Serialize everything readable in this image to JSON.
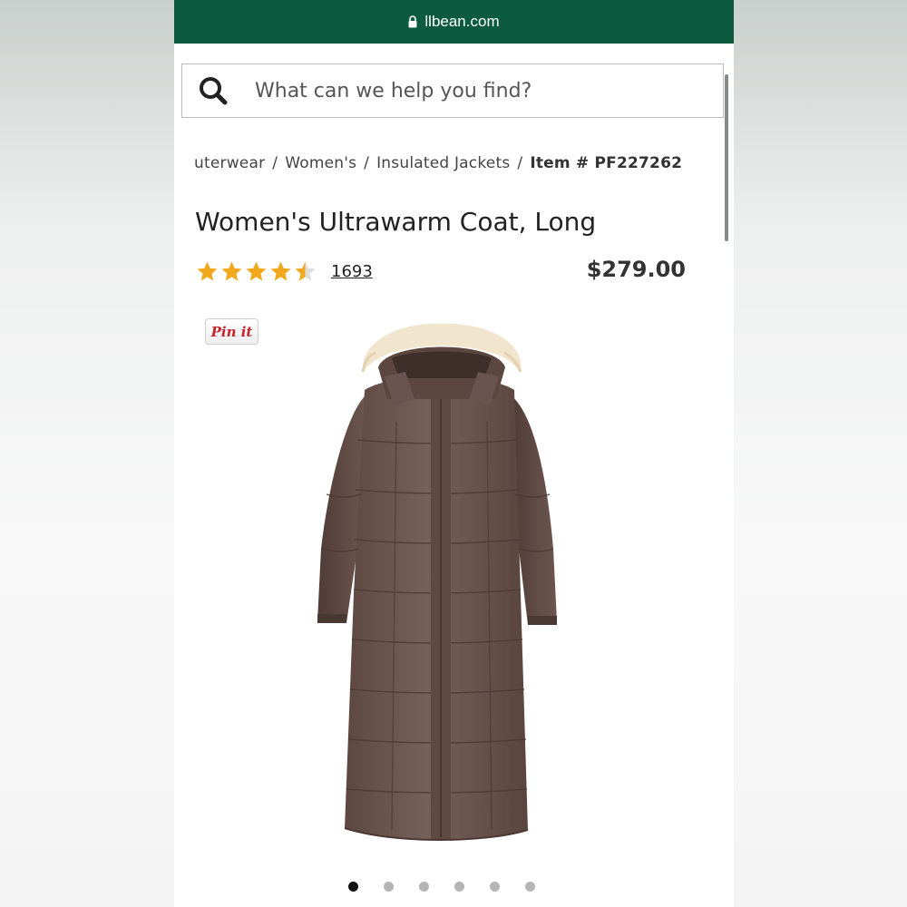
{
  "browser": {
    "url": "llbean.com"
  },
  "search": {
    "placeholder": "What can we help you find?"
  },
  "breadcrumb": {
    "items": [
      "uterwear",
      "Women's",
      "Insulated Jackets"
    ],
    "item_number": "Item # PF227262",
    "separator": "/"
  },
  "product": {
    "title": "Women's Ultrawarm Coat, Long",
    "rating": 4.5,
    "max_rating": 5,
    "review_count": "1693",
    "price": "$279.00",
    "image_alt": "Women's Ultrawarm Coat, Long in brown with fur-trimmed hood"
  },
  "pinit": {
    "label": "Pin it"
  },
  "carousel": {
    "count": 6,
    "active_index": 0
  },
  "colors": {
    "header_green": "#0c5a3f",
    "star_gold": "#f2a81d",
    "coat_brown": "#6e5650",
    "pin_red": "#c8232c"
  },
  "icons": {
    "lock": "lock-icon",
    "search": "search-icon",
    "star": "star-icon"
  }
}
